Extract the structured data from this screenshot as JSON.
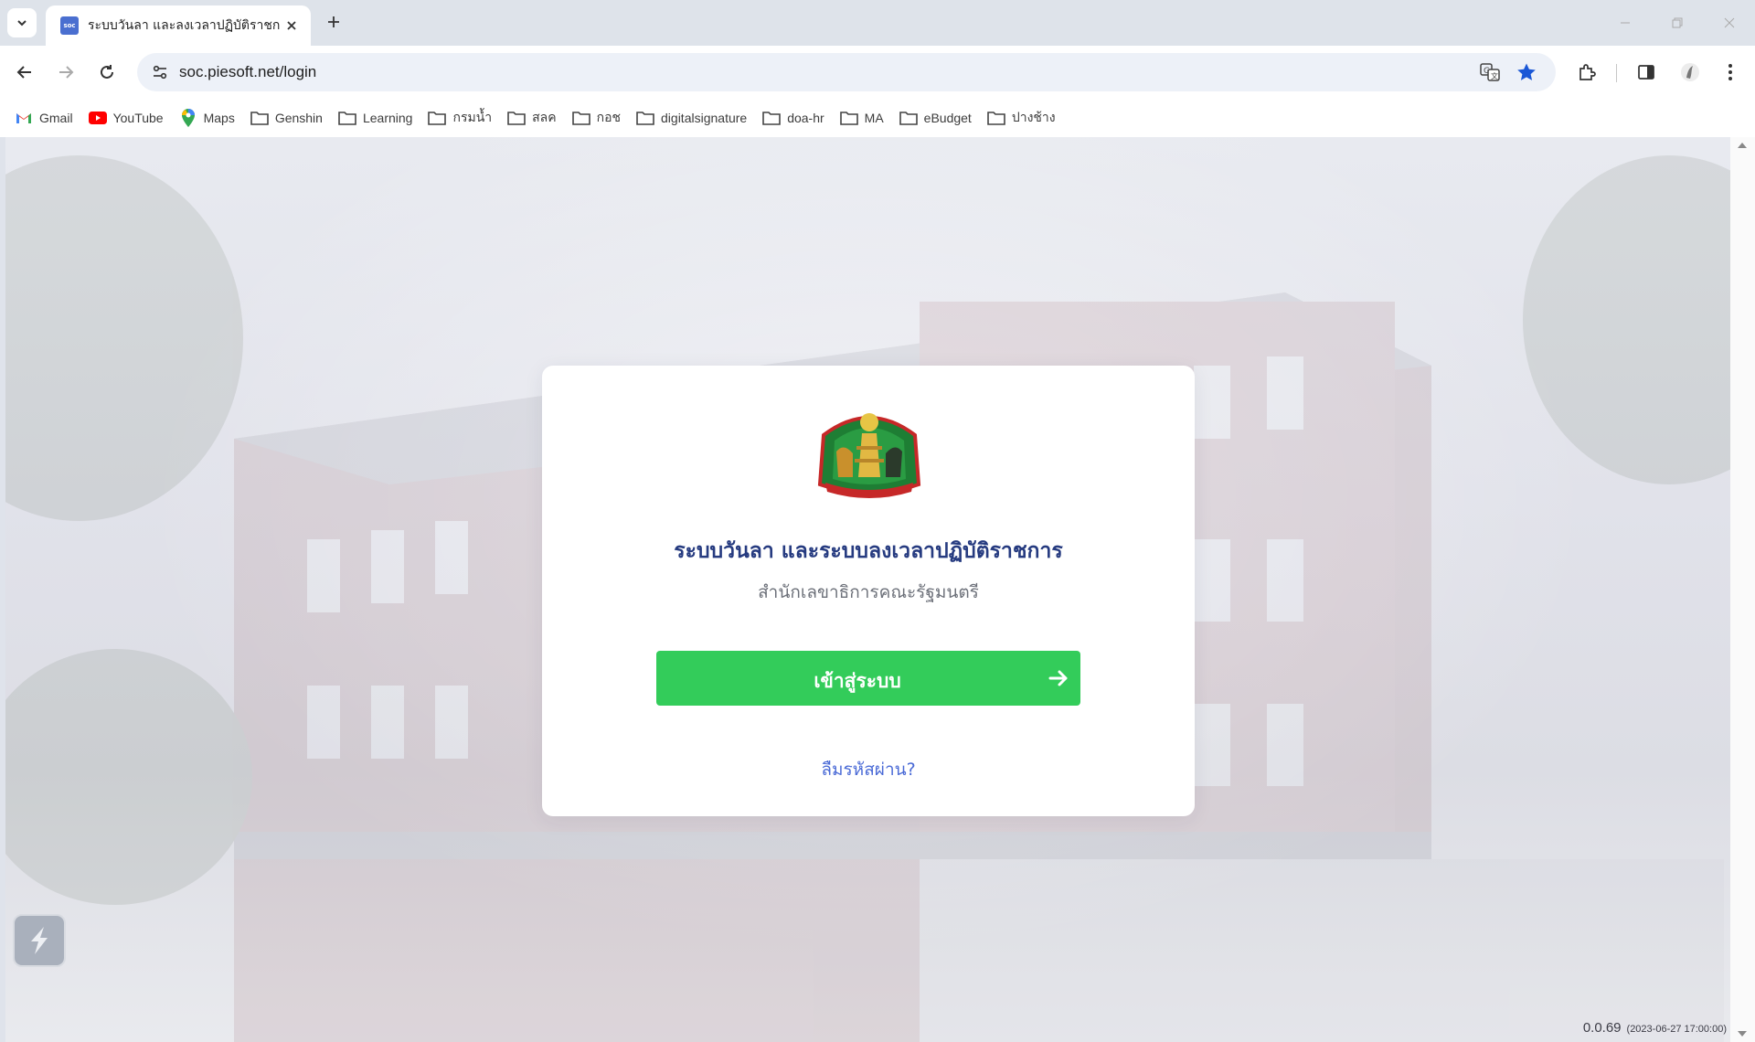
{
  "browser": {
    "tab": {
      "title": "ระบบวันลา และลงเวลาปฏิบัติราชการ",
      "favicon_text": "soc"
    },
    "url": "soc.piesoft.net/login",
    "bookmarks": [
      {
        "label": "Gmail",
        "icon": "gmail-icon"
      },
      {
        "label": "YouTube",
        "icon": "youtube-icon"
      },
      {
        "label": "Maps",
        "icon": "maps-icon"
      },
      {
        "label": "Genshin",
        "icon": "folder-icon"
      },
      {
        "label": "Learning",
        "icon": "folder-icon"
      },
      {
        "label": "กรมน้ำ",
        "icon": "folder-icon"
      },
      {
        "label": "สลค",
        "icon": "folder-icon"
      },
      {
        "label": "กอช",
        "icon": "folder-icon"
      },
      {
        "label": "digitalsignature",
        "icon": "folder-icon"
      },
      {
        "label": "doa-hr",
        "icon": "folder-icon"
      },
      {
        "label": "MA",
        "icon": "folder-icon"
      },
      {
        "label": "eBudget",
        "icon": "folder-icon"
      },
      {
        "label": "ปางช้าง",
        "icon": "folder-icon"
      }
    ]
  },
  "login": {
    "title": "ระบบวันลา และระบบลงเวลาปฏิบัติราชการ",
    "subtitle": "สำนักเลขาธิการคณะรัฐมนตรี",
    "button_label": "เข้าสู่ระบบ",
    "forgot_label": "ลืมรหัสผ่าน?"
  },
  "footer": {
    "version": "0.0.69",
    "build_date": "(2023-06-27 17:00:00)"
  },
  "colors": {
    "primary_button": "#33cc5a",
    "title": "#263b80",
    "link": "#4a6ad6",
    "bookmark_star": "#1a57d6"
  }
}
